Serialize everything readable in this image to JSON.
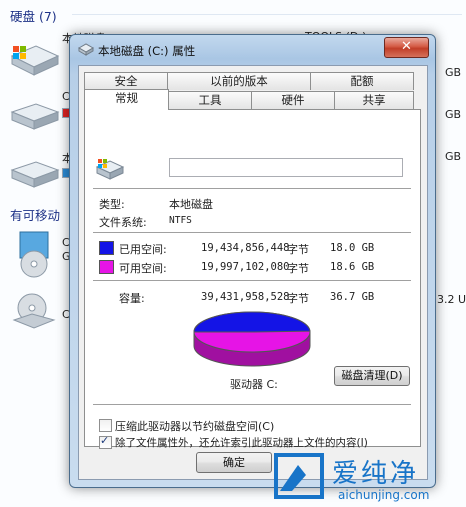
{
  "explorer": {
    "group_hard_disk": "硬盘 (7)",
    "group_removable": "有可移动",
    "drive_c_partial": "本地磁盘 (C:)",
    "drive_d_partial": "TOOLS (D:)",
    "drive_c_letter": "C",
    "drive_b_letter": "C",
    "drive_local_partial": "本",
    "removable_1": "C",
    "removable_1b": "G",
    "removable_2": "C",
    "right_cut_1": "GB",
    "right_cut_2": "GB",
    "right_cut_3": "GB",
    "right_cut_4": "3.2 U"
  },
  "dialog": {
    "title": "本地磁盘 (C:) 属性",
    "close_glyph": "✕",
    "tabs_back": [
      "安全",
      "以前的版本",
      "配额"
    ],
    "tabs_front": [
      "常规",
      "工具",
      "硬件",
      "共享"
    ],
    "active_tab": "常规",
    "drive_name_value": "",
    "type_label": "类型:",
    "type_value": "本地磁盘",
    "fs_label": "文件系统:",
    "fs_value": "NTFS",
    "used_label": "已用空间:",
    "used_bytes": "19,434,856,448",
    "used_unit": "字节",
    "used_gb": "18.0 GB",
    "free_label": "可用空间:",
    "free_bytes": "19,997,102,080",
    "free_unit": "字节",
    "free_gb": "18.6 GB",
    "capacity_label": "容量:",
    "capacity_bytes": "39,431,958,528",
    "capacity_unit": "字节",
    "capacity_gb": "36.7 GB",
    "drive_label": "驱动器 C:",
    "cleanup_button": "磁盘清理(D)",
    "compress_label": "压缩此驱动器以节约磁盘空间(C)",
    "compress_checked": false,
    "index_label": "除了文件属性外，还允许索引此驱动器上文件的内容(I)",
    "index_checked": true,
    "index_check_glyph": "✓",
    "ok_button": "确定",
    "used_fraction": 0.493,
    "used_color": "#1414e6",
    "free_color": "#e614e6"
  },
  "watermark": {
    "brand_cn": "爱纯净",
    "brand_url": "aichunjing.com",
    "color": "#1874c8"
  }
}
